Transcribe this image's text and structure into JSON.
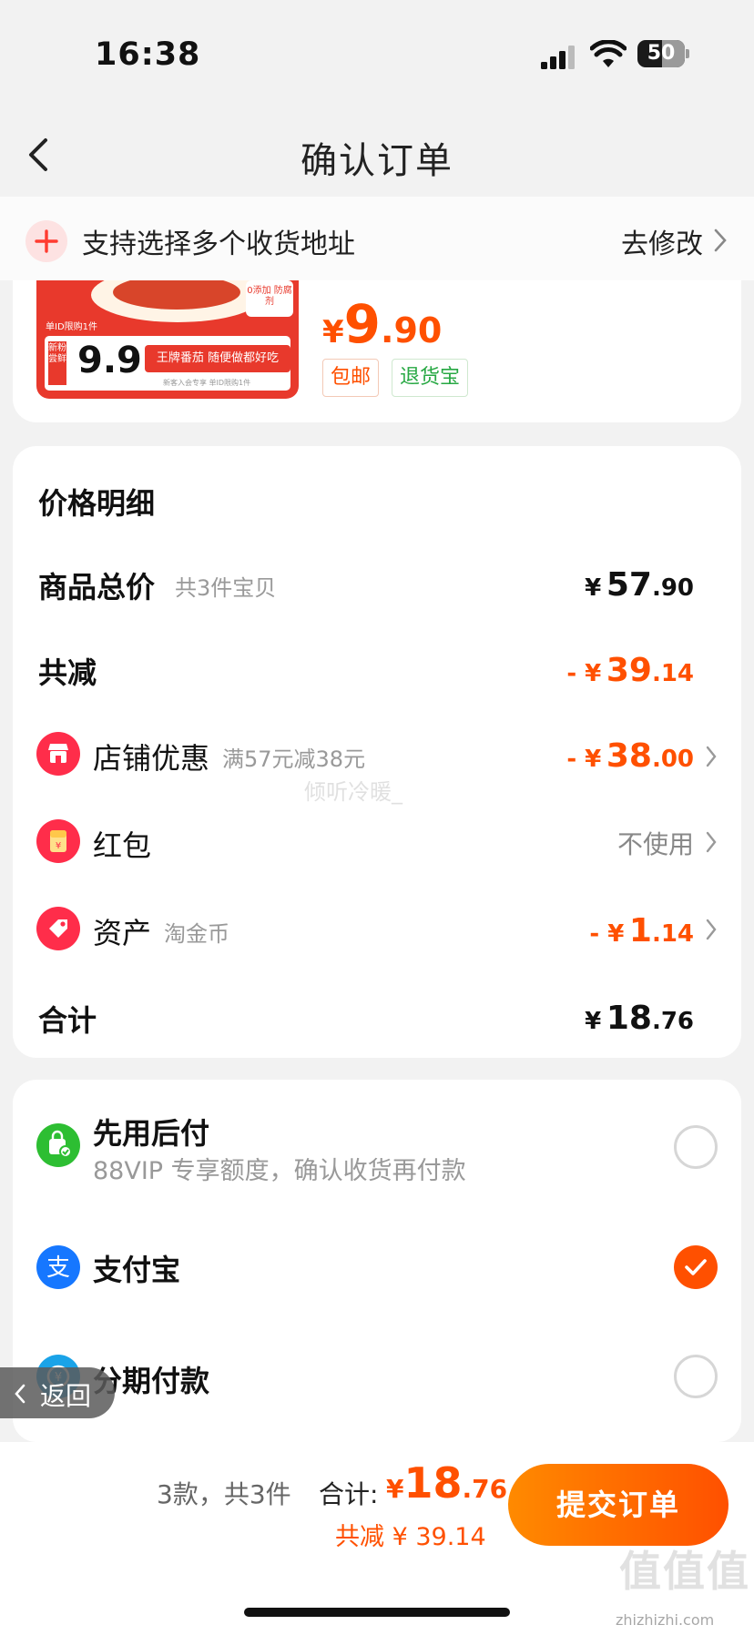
{
  "status_bar": {
    "time": "16:38",
    "battery": "50"
  },
  "nav": {
    "title": "确认订单"
  },
  "address_banner": {
    "text": "支持选择多个收货地址",
    "edit_label": "去修改"
  },
  "product": {
    "image_text": {
      "promo_price": "9.9",
      "promo_slogan": "王牌番茄 随便做都好吃",
      "badge": "新粉尝鲜",
      "limit": "单ID限购1件",
      "zero_add": "0添加 防腐剂",
      "footnote": "新客入会专享 单ID限购1件"
    },
    "price_currency": "¥",
    "price_int": "9",
    "price_dec": ".90",
    "tags": [
      "包邮",
      "退货宝"
    ]
  },
  "price_detail": {
    "title": "价格明细",
    "goods_total": {
      "label": "商品总价",
      "note": "共3件宝贝",
      "currency": "¥",
      "int": "57",
      "dec": ".90"
    },
    "total_reduce": {
      "label": "共减",
      "currency": "- ¥",
      "int": "39",
      "dec": ".14"
    },
    "shop_discount": {
      "label": "店铺优惠",
      "note": "满57元减38元",
      "currency": "- ¥",
      "int": "38",
      "dec": ".00"
    },
    "red_packet": {
      "label": "红包",
      "value": "不使用"
    },
    "assets": {
      "label": "资产",
      "note": "淘金币",
      "currency": "- ¥",
      "int": "1",
      "dec": ".14"
    },
    "sum": {
      "label": "合计",
      "currency": "¥",
      "int": "18",
      "dec": ".76"
    }
  },
  "payment": {
    "options": [
      {
        "name": "先用后付",
        "desc": "88VIP 专享额度，确认收货再付款",
        "selected": false
      },
      {
        "name": "支付宝",
        "selected": true
      },
      {
        "name": "分期付款",
        "selected": false
      }
    ]
  },
  "back_pill": {
    "label": "返回"
  },
  "bottom_bar": {
    "count": "3款，共3件",
    "total_label": "合计:",
    "currency": "¥",
    "total_int": "18",
    "total_dec": ".76",
    "saving": "共减 ¥ 39.14",
    "submit_label": "提交订单"
  },
  "watermarks": {
    "center": "倾听冷暖_",
    "site": "zhizhizhi.com",
    "logo": "值值值"
  },
  "colors": {
    "accent": "#ff5000",
    "accent_gradient_start": "#ff8a00",
    "green": "#27a843",
    "alipay_blue": "#1677ff",
    "background": "#f2f2f2"
  },
  "icons": [
    "signal-icon",
    "wifi-icon",
    "battery-icon",
    "back-chevron-icon",
    "plus-icon",
    "shop-icon",
    "red-packet-icon",
    "asset-tag-icon",
    "bag-check-icon",
    "alipay-icon",
    "installment-icon",
    "check-icon"
  ]
}
